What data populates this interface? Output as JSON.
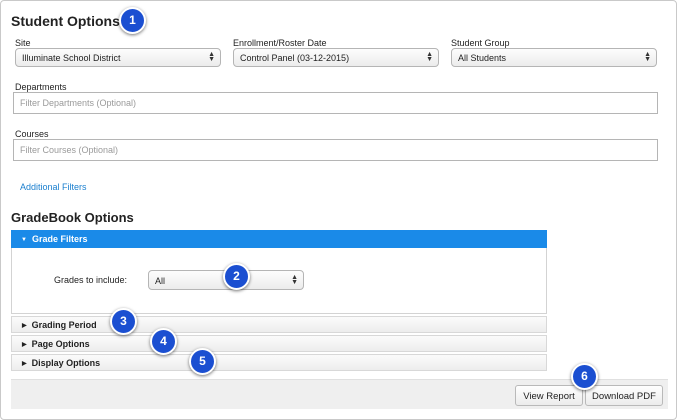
{
  "student_options": {
    "title": "Student Options",
    "site": {
      "label": "Site",
      "value": "Illuminate School District"
    },
    "enrollment": {
      "label": "Enrollment/Roster Date",
      "value": "Control Panel (03-12-2015)"
    },
    "student_group": {
      "label": "Student Group",
      "value": "All Students"
    },
    "departments": {
      "label": "Departments",
      "placeholder": "Filter Departments (Optional)"
    },
    "courses": {
      "label": "Courses",
      "placeholder": "Filter Courses (Optional)"
    },
    "additional_filters": "Additional Filters"
  },
  "gradebook_options": {
    "title": "GradeBook Options",
    "grade_filters": {
      "title": "Grade Filters",
      "grades_label": "Grades to include:",
      "grades_value": "All"
    },
    "sections": {
      "grading_period": "Grading Period",
      "page_options": "Page Options",
      "display_options": "Display Options"
    }
  },
  "footer": {
    "view_report": "View Report",
    "download_pdf": "Download PDF"
  },
  "badges": [
    "1",
    "2",
    "3",
    "4",
    "5",
    "6"
  ],
  "colors": {
    "accent": "#1a8ae8",
    "link": "#1a7fcf",
    "badge": "#1b4fd1"
  }
}
